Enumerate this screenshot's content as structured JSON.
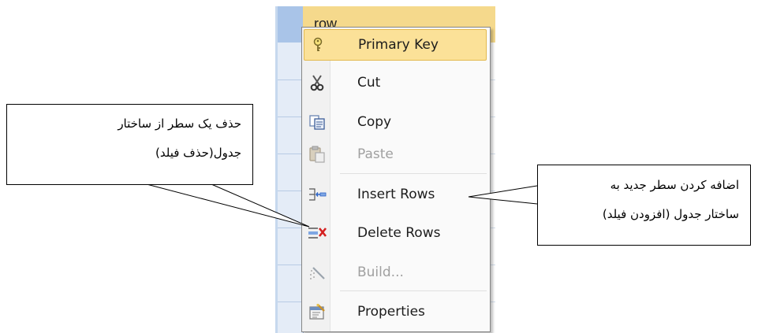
{
  "grid": {
    "header_text": "row"
  },
  "menu": {
    "items": [
      {
        "label": "Primary Key",
        "icon": "key-icon",
        "enabled": true,
        "highlighted": true
      },
      {
        "label": "Cut",
        "icon": "scissors-icon",
        "enabled": true,
        "highlighted": false
      },
      {
        "label": "Copy",
        "icon": "copy-icon",
        "enabled": true,
        "highlighted": false
      },
      {
        "label": "Paste",
        "icon": "paste-icon",
        "enabled": false,
        "highlighted": false
      },
      {
        "label": "Insert Rows",
        "icon": "insert-rows-icon",
        "enabled": true,
        "highlighted": false
      },
      {
        "label": "Delete Rows",
        "icon": "delete-rows-icon",
        "enabled": true,
        "highlighted": false
      },
      {
        "label": "Build...",
        "icon": "build-wand-icon",
        "enabled": false,
        "highlighted": false
      },
      {
        "label": "Properties",
        "icon": "properties-icon",
        "enabled": true,
        "highlighted": false
      }
    ]
  },
  "callouts": {
    "delete": {
      "line1": "حذف یک سطر از ساختار",
      "line2": "جدول(حذف فیلد)"
    },
    "insert": {
      "line1": "اضافه کردن سطر جدید به",
      "line2": "ساختار جدول  (افزودن فیلد)"
    }
  },
  "colors": {
    "highlight": "#fbe198",
    "header": "#f5d98c",
    "selector": "#e4ecf7"
  }
}
